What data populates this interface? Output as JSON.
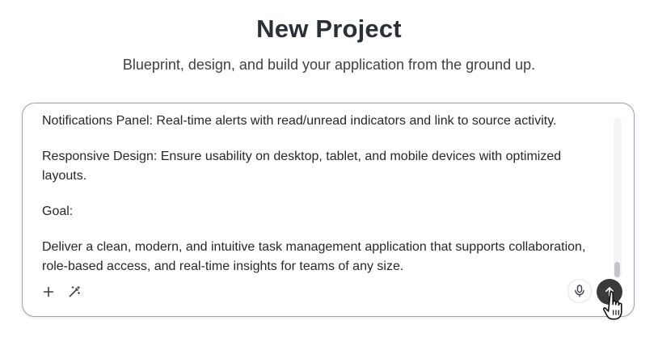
{
  "header": {
    "title": "New Project",
    "subtitle": "Blueprint, design, and build your application from the ground up."
  },
  "composer": {
    "paragraphs": [
      "Notifications Panel: Real-time alerts with read/unread indicators and link to source activity.",
      "Responsive Design: Ensure usability on desktop, tablet, and mobile devices with optimized layouts.",
      "Goal:",
      "Deliver a clean, modern, and intuitive task management application that supports collaboration, role-based access, and real-time insights for teams of any size."
    ],
    "toolbar": {
      "add_icon": "plus-icon",
      "enhance_icon": "magic-wand-icon",
      "mic_icon": "microphone-icon",
      "send_icon": "arrow-up-icon"
    }
  },
  "colors": {
    "send_button": "#3a3a3d",
    "border": "#a1a1aa"
  }
}
